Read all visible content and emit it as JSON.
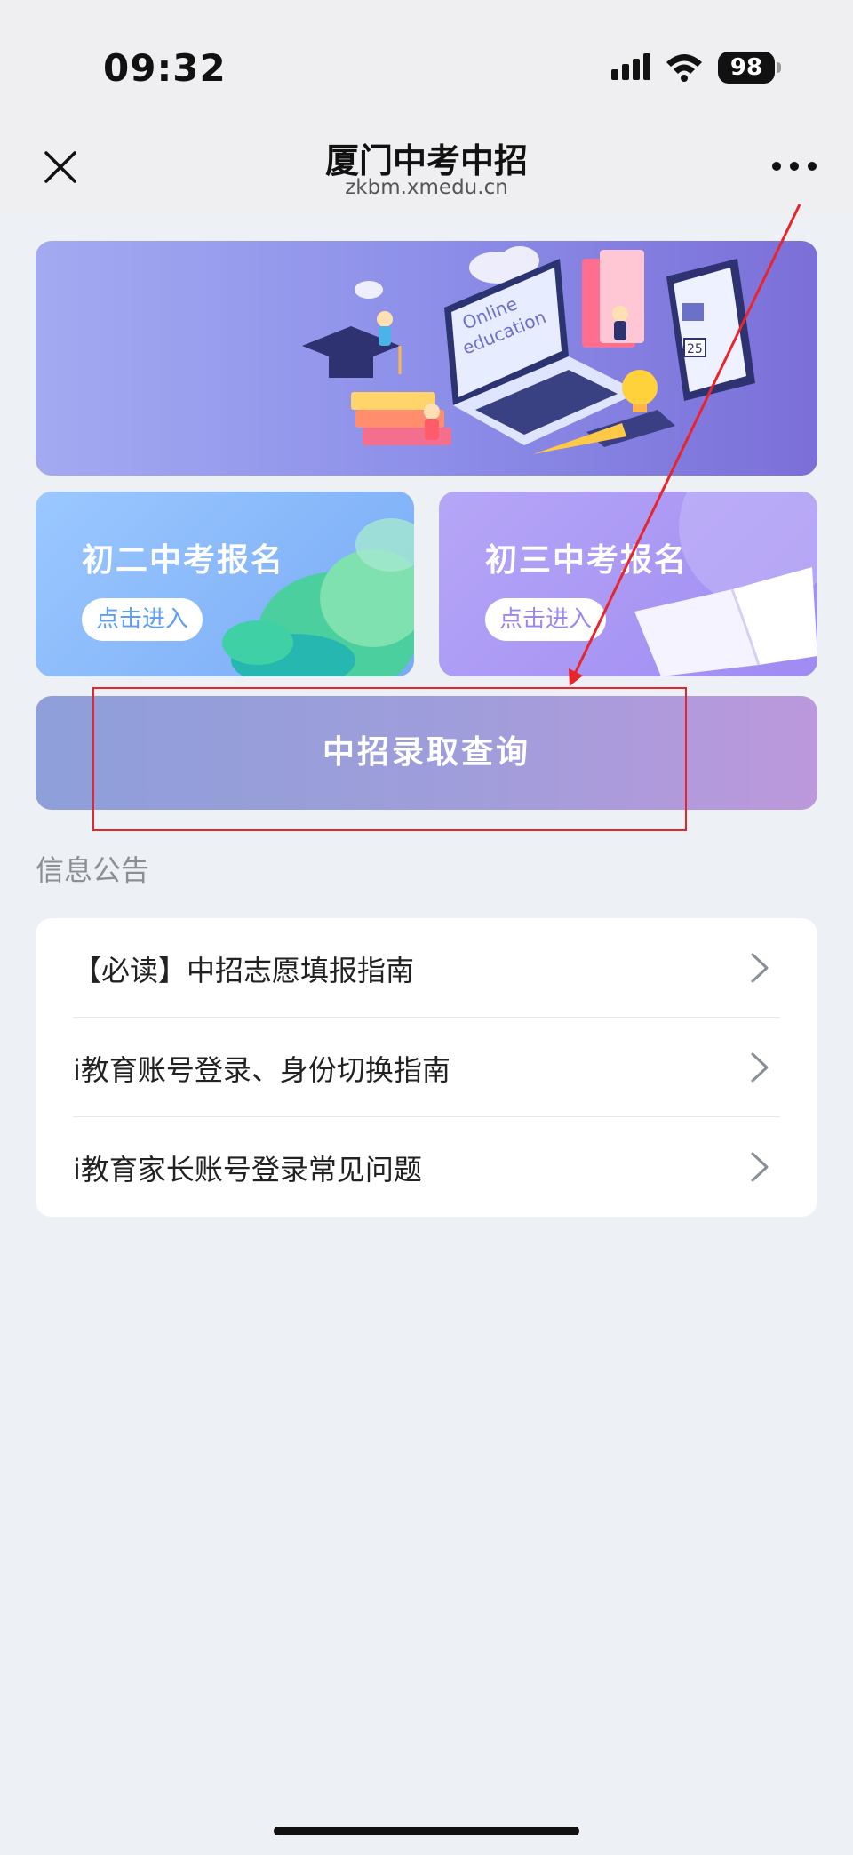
{
  "status_bar": {
    "time": "09:32",
    "battery": "98"
  },
  "header": {
    "title": "厦门中考中招",
    "url": "zkbm.xmedu.cn"
  },
  "banner": {
    "laptop_text_1": "Online",
    "laptop_text_2": "education",
    "calendar_number": "25"
  },
  "entries": [
    {
      "title": "初二中考报名",
      "button": "点击进入"
    },
    {
      "title": "初三中考报名",
      "button": "点击进入"
    }
  ],
  "query_button": "中招录取查询",
  "notices": {
    "section_label": "信息公告",
    "items": [
      {
        "label": "【必读】中招志愿填报指南"
      },
      {
        "label": "i教育账号登录、身份切换指南"
      },
      {
        "label": "i教育家长账号登录常见问题"
      }
    ]
  },
  "colors": {
    "annotation": "#e8252b",
    "accent_blue": "#5d9df3",
    "accent_purple": "#9c86ef"
  },
  "icons": [
    "close-icon",
    "more-icon",
    "signal-icon",
    "wifi-icon",
    "battery-icon",
    "chevron-right-icon"
  ]
}
